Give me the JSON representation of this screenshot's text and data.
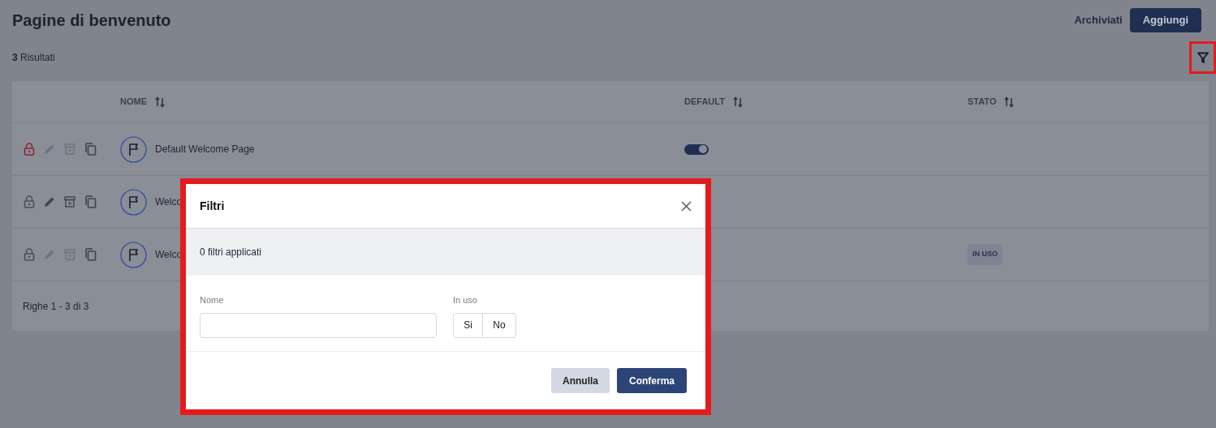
{
  "page": {
    "title": "Pagine di benvenuto",
    "actions": [
      "Archiviati",
      "Aggiungi"
    ],
    "results": "**3** Risultati"
  },
  "table": {
    "columns": [
      "NOME",
      "DEFAULT",
      "STATO"
    ],
    "rows": [
      {
        "locked": true,
        "edit_enabled": false,
        "archive_enabled": false,
        "name": "Default Welcome Page",
        "default": true
      },
      {
        "locked": false,
        "edit_enabled": true,
        "archive_enabled": true,
        "name": "Welco"
      },
      {
        "locked": false,
        "edit_enabled": false,
        "archive_enabled": false,
        "name": "Welco",
        "status": "IN USO"
      }
    ],
    "footer": "Righe 1 - 3 di 3"
  },
  "dialog": {
    "title": "Filtri",
    "applied": "0 filtri applicati",
    "name_label": "Nome",
    "in_use_label": "In uso",
    "in_use_options": [
      {
        "label": "Si",
        "selected": false
      },
      {
        "label": "No",
        "selected": false
      }
    ],
    "buttons": [
      "Annulla",
      "Conferma"
    ]
  }
}
